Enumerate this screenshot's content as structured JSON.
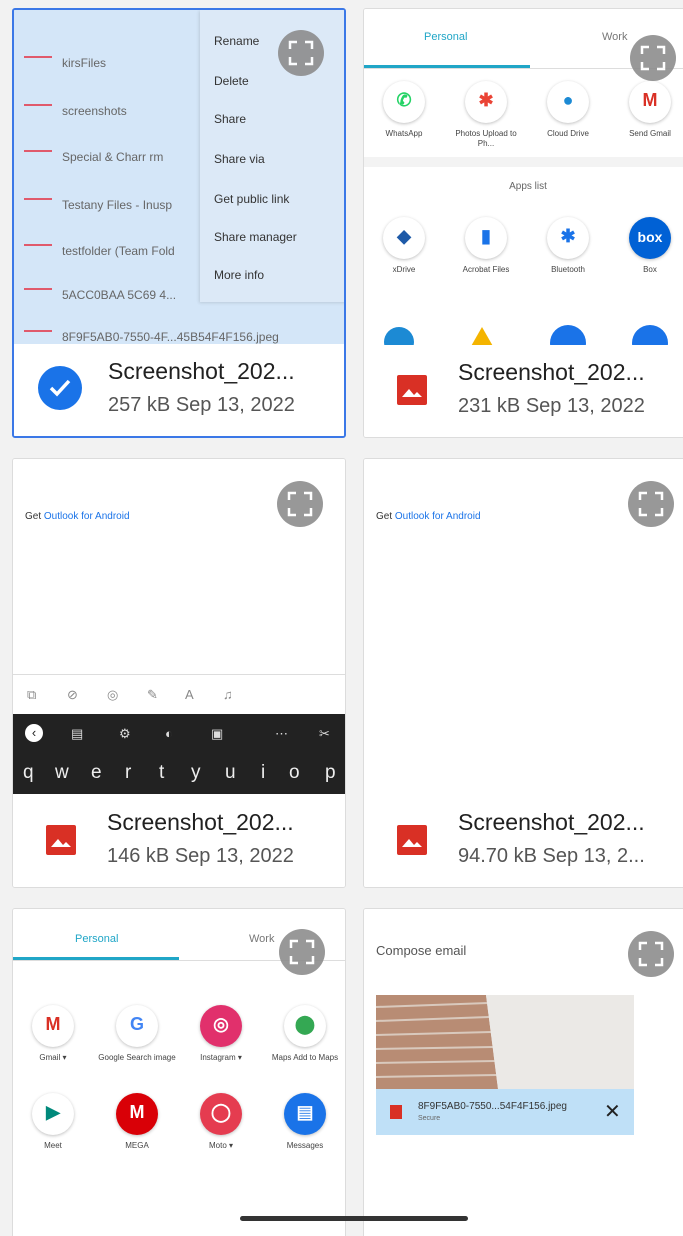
{
  "cards": [
    {
      "name": "Screenshot_202...",
      "meta": "257 kB Sep 13, 2022",
      "selected": true
    },
    {
      "name": "Screenshot_202...",
      "meta": "231 kB Sep 13, 2022"
    },
    {
      "name": "Screenshot_202...",
      "meta": "146 kB Sep 13, 2022"
    },
    {
      "name": "Screenshot_202...",
      "meta": "94.70 kB Sep 13, 2..."
    }
  ],
  "thumb1": {
    "rows": [
      "kirsFiles",
      "screenshots",
      "Special & Charr rm",
      "Testany Files - Inusp",
      "testfolder (Team Fold",
      "5ACC0BAA 5C69 4...",
      "8F9F5AB0-7550-4F...45B54F4F156.jpeg"
    ],
    "menu": [
      "Rename",
      "Delete",
      "Share",
      "Share via",
      "Get public link",
      "Share manager",
      "More info"
    ]
  },
  "share1": {
    "tab_personal": "Personal",
    "tab_work": "Work",
    "apps": [
      {
        "label": "WhatsApp",
        "glyph": "✆",
        "color": "#25d366"
      },
      {
        "label": "Photos Upload to Ph...",
        "glyph": "✱",
        "color": "#ea4335"
      },
      {
        "label": "Cloud Drive",
        "glyph": "●",
        "color": "#1c8ad4"
      },
      {
        "label": "Send Gmail",
        "glyph": "M",
        "color": "#d93025"
      }
    ],
    "section": "Apps list",
    "apps2": [
      {
        "label": "xDrive",
        "glyph": "◆",
        "color": "#1e5aa8"
      },
      {
        "label": "Acrobat Files",
        "glyph": "▮",
        "color": "#1a73e8"
      },
      {
        "label": "Bluetooth",
        "glyph": "✱",
        "color": "#1a73e8"
      },
      {
        "label": "Box",
        "glyph": "box",
        "color": "#0061d5"
      }
    ]
  },
  "outlook": {
    "prefix": "Get ",
    "link": "Outlook for Android",
    "toolbar": [
      "⧉",
      "⊘",
      "◎",
      "✎",
      "A",
      "♫"
    ],
    "kbd_tools": [
      "‹",
      "▤",
      "⚙",
      "◐",
      "▣",
      "⋯",
      "✂"
    ],
    "keys": [
      "q",
      "w",
      "e",
      "r",
      "t",
      "y",
      "u",
      "i",
      "o",
      "p"
    ]
  },
  "share2": {
    "tab_personal": "Personal",
    "tab_work": "Work",
    "apps": [
      {
        "label": "Gmail ▾",
        "glyph": "M",
        "color": "#d93025"
      },
      {
        "label": "Google Search image",
        "glyph": "G",
        "color": "#4285f4"
      },
      {
        "label": "Instagram ▾",
        "glyph": "◎",
        "color": "#e1306c"
      },
      {
        "label": "Maps Add to Maps",
        "glyph": "⬤",
        "color": "#34a853"
      },
      {
        "label": "Meet",
        "glyph": "▶",
        "color": "#00897b"
      },
      {
        "label": "MEGA",
        "glyph": "M",
        "color": "#d90007"
      },
      {
        "label": "Moto ▾",
        "glyph": "◯",
        "color": "#e53c50"
      },
      {
        "label": "Messages",
        "glyph": "▤",
        "color": "#1a73e8"
      }
    ]
  },
  "compose": {
    "title": "Compose email",
    "attachment": "8F9F5AB0-7550...54F4F156.jpeg",
    "size": "Secure",
    "close": "✕"
  }
}
